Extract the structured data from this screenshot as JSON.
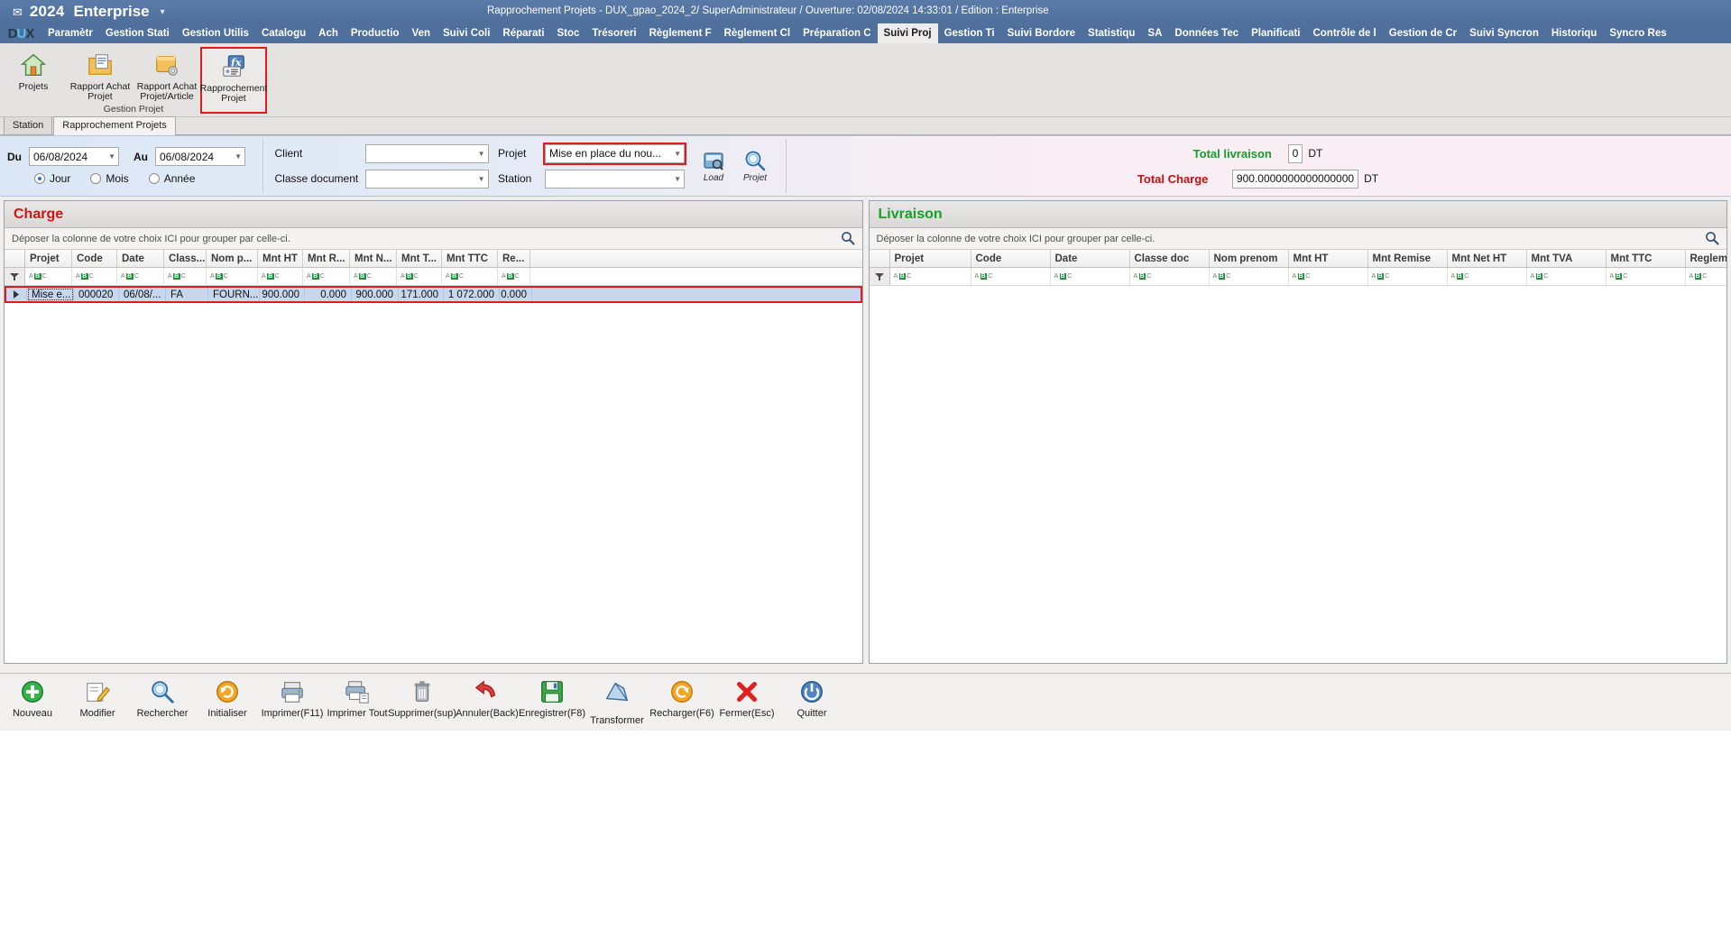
{
  "titlebar": {
    "app_icon": "envelope-icon",
    "year": "2024",
    "edition": "Enterprise",
    "dropdown_caret": "▾",
    "document_title": "Rapprochement Projets - DUX_gpao_2024_2/ SuperAdministrateur / Ouverture: 02/08/2024 14:33:01 / Edition : Enterprise"
  },
  "menubar": {
    "logo": "DUXY",
    "items": [
      {
        "label": "Paramètr",
        "active": false
      },
      {
        "label": "Gestion Stati",
        "active": false
      },
      {
        "label": "Gestion Utilis",
        "active": false
      },
      {
        "label": "Catalogu",
        "active": false
      },
      {
        "label": "Ach",
        "active": false
      },
      {
        "label": "Productio",
        "active": false
      },
      {
        "label": "Ven",
        "active": false
      },
      {
        "label": "Suivi Coli",
        "active": false
      },
      {
        "label": "Réparati",
        "active": false
      },
      {
        "label": "Stoc",
        "active": false
      },
      {
        "label": "Trésoreri",
        "active": false
      },
      {
        "label": "Règlement F",
        "active": false
      },
      {
        "label": "Règlement Cl",
        "active": false
      },
      {
        "label": "Préparation C",
        "active": false
      },
      {
        "label": "Suivi Proj",
        "active": true
      },
      {
        "label": "Gestion Ti",
        "active": false
      },
      {
        "label": "Suivi Bordore",
        "active": false
      },
      {
        "label": "Statistiqu",
        "active": false
      },
      {
        "label": "SA",
        "active": false
      },
      {
        "label": "Données Tec",
        "active": false
      },
      {
        "label": "Planificati",
        "active": false
      },
      {
        "label": "Contrôle de l",
        "active": false
      },
      {
        "label": "Gestion de Cr",
        "active": false
      },
      {
        "label": "Suivi Syncron",
        "active": false
      },
      {
        "label": "Historiqu",
        "active": false
      },
      {
        "label": "Syncro Res",
        "active": false
      }
    ]
  },
  "ribbon": {
    "group_title": "Gestion Projet",
    "buttons": [
      {
        "label": "Projets",
        "icon": "home-icon",
        "selected": false
      },
      {
        "label": "Rapport Achat Projet",
        "icon": "folder-document-icon",
        "selected": false
      },
      {
        "label": "Rapport Achat Projet/Article",
        "icon": "folder-gear-icon",
        "selected": false
      },
      {
        "label": "Rapprochement Projet",
        "icon": "fx-formula-icon",
        "selected": true
      }
    ]
  },
  "doc_tabs": [
    {
      "label": "Station",
      "active": false
    },
    {
      "label": "Rapprochement Projets",
      "active": true
    }
  ],
  "filters": {
    "du_label": "Du",
    "du_value": "06/08/2024",
    "au_label": "Au",
    "au_value": "06/08/2024",
    "period_options": [
      {
        "label": "Jour",
        "selected": true
      },
      {
        "label": "Mois",
        "selected": false
      },
      {
        "label": "Année",
        "selected": false
      }
    ],
    "client_label": "Client",
    "client_value": "",
    "classe_document_label": "Classe document",
    "classe_document_value": "",
    "projet_label": "Projet",
    "projet_value": "Mise en place du nou...",
    "station_label": "Station",
    "station_value": "",
    "load_button": {
      "label": "Load",
      "icon": "load-disk-icon"
    },
    "projet_button": {
      "label": "Projet",
      "icon": "magnifier-icon"
    },
    "total_livraison_label": "Total livraison",
    "total_livraison_value": "0",
    "total_livraison_unit": "DT",
    "total_charge_label": "Total Charge",
    "total_charge_value": "900.0000000000000000",
    "total_charge_unit": "DT"
  },
  "charge_panel": {
    "title": "Charge",
    "group_hint": "Déposer la colonne de votre choix ICI pour grouper par celle-ci.",
    "search_icon": "search-icon",
    "columns": [
      "Projet",
      "Code",
      "Date",
      "Class...",
      "Nom p...",
      "Mnt HT",
      "Mnt R...",
      "Mnt N...",
      "Mnt T...",
      "Mnt TTC",
      "Re..."
    ],
    "filter_row_icon": "abc-filter-icon",
    "rows": [
      {
        "selected": true,
        "cells": [
          "Mise e...",
          "000020",
          "06/08/...",
          "FA",
          "FOURN...",
          "900.000",
          "0.000",
          "900.000",
          "171.000",
          "1 072.000",
          "0.000"
        ]
      }
    ]
  },
  "livraison_panel": {
    "title": "Livraison",
    "group_hint": "Déposer la colonne de votre choix ICI pour grouper par celle-ci.",
    "search_icon": "search-icon",
    "columns": [
      "Projet",
      "Code",
      "Date",
      "Classe doc",
      "Nom prenom",
      "Mnt HT",
      "Mnt Remise",
      "Mnt Net HT",
      "Mnt TVA",
      "Mnt TTC",
      "Reglement"
    ],
    "filter_row_icon": "abc-filter-icon",
    "rows": []
  },
  "bottom_toolbar": [
    {
      "label": "Nouveau",
      "icon": "plus-circle-icon"
    },
    {
      "label": "Modifier",
      "icon": "pencil-edit-icon"
    },
    {
      "label": "Rechercher",
      "icon": "magnifier-icon"
    },
    {
      "label": "Initialiser",
      "icon": "refresh-circle-icon"
    },
    {
      "label": "Imprimer(F11)",
      "icon": "printer-icon"
    },
    {
      "label": "Imprimer Tout",
      "icon": "printer-all-icon"
    },
    {
      "label": "Supprimer(sup)",
      "icon": "trash-icon"
    },
    {
      "label": "Annuler(Back)",
      "icon": "undo-arrow-icon"
    },
    {
      "label": "Enregistrer(F8)",
      "icon": "floppy-save-icon"
    },
    {
      "label": "Transformer",
      "icon": "transform-icon"
    },
    {
      "label": "Recharger(F6)",
      "icon": "reload-icon"
    },
    {
      "label": "Fermer(Esc)",
      "icon": "close-x-icon"
    },
    {
      "label": "Quitter",
      "icon": "power-icon"
    }
  ],
  "colors": {
    "titlebar": "#4f6f9c",
    "accent_red": "#e01b1b",
    "charge_title": "#cf1414",
    "livraison_title": "#12a02b",
    "row_selected": "#c7d7ee"
  }
}
